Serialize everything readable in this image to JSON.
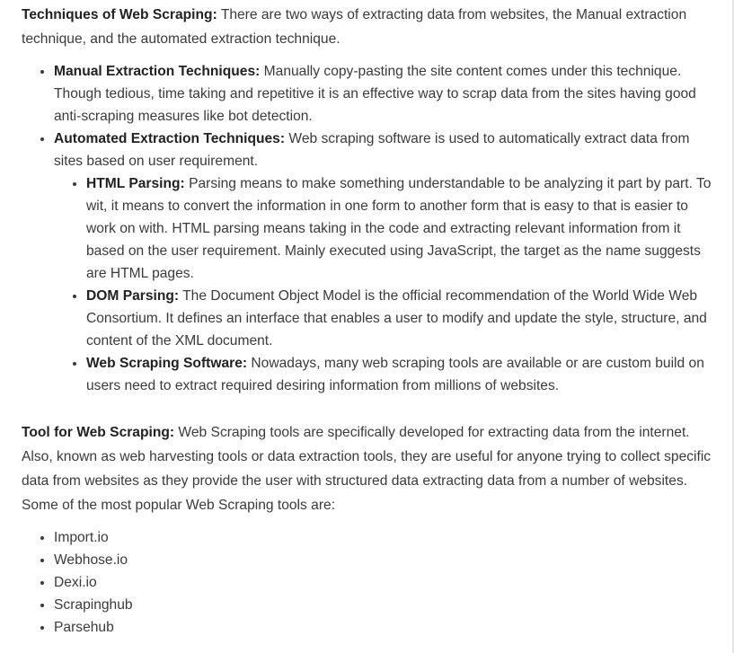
{
  "techniques": {
    "heading": "Techniques of Web Scraping:",
    "intro": " There are two ways of extracting data from websites, the Manual extraction technique, and the automated extraction technique.",
    "items": [
      {
        "label": "Manual Extraction Techniques:",
        "text": " Manually copy-pasting the site content comes under this technique. Though tedious, time taking and repetitive it is an effective way to scrap data from the sites having good anti-scraping measures like bot detection."
      },
      {
        "label": "Automated Extraction Techniques:",
        "text": " Web scraping software is used to automatically extract data from sites based on user requirement.",
        "subitems": [
          {
            "label": "HTML Parsing:",
            "text": " Parsing means to make something understandable to be analyzing it part by part. To wit, it means to convert the information in one form to another form that is easy to that is easier to work on with. HTML parsing means taking in the code and extracting relevant information from it based on the user requirement. Mainly executed using JavaScript, the target as the name suggests are HTML pages."
          },
          {
            "label": "DOM Parsing:",
            "text": " The Document Object Model is the official recommendation of the World Wide Web Consortium. It defines an interface that enables a user to modify and update the style, structure, and content of the XML document."
          },
          {
            "label": "Web Scraping Software:",
            "text": " Nowadays, many web scraping tools are available or are custom build on users need to extract required desiring information from millions of websites."
          }
        ]
      }
    ]
  },
  "tools": {
    "heading": "Tool for Web Scraping:",
    "intro": " Web Scraping tools are specifically developed for extracting data from the internet. Also, known as web harvesting tools or data extraction tools, they are useful for anyone trying to collect specific data from websites as they provide the user with structured data extracting data from a number of websites. Some of the most popular Web Scraping tools are:",
    "list": [
      "Import.io",
      "Webhose.io",
      "Dexi.io",
      "Scrapinghub",
      "Parsehub"
    ]
  }
}
